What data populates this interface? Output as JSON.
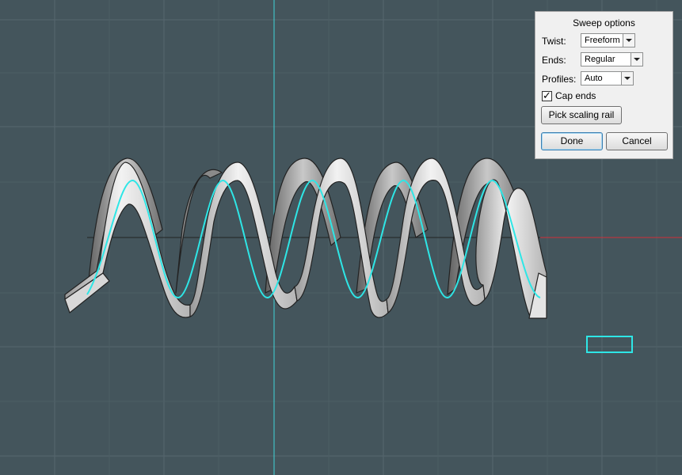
{
  "sweep_options": {
    "title": "Sweep options",
    "twist_label": "Twist:",
    "twist_value": "Freeform",
    "ends_label": "Ends:",
    "ends_value": "Regular",
    "profiles_label": "Profiles:",
    "profiles_value": "Auto",
    "cap_ends_label": "Cap ends",
    "cap_ends_checked": true,
    "pick_rail_label": "Pick scaling rail",
    "done_label": "Done",
    "cancel_label": "Cancel"
  },
  "viewport": {
    "background_color": "#44555c",
    "grid_color": "#56676e",
    "axis_y_color": "#3fd4d8",
    "axis_x_color": "#d0303a",
    "curve_color": "#2ee6e6",
    "surface_color": "#dcdcdc"
  }
}
